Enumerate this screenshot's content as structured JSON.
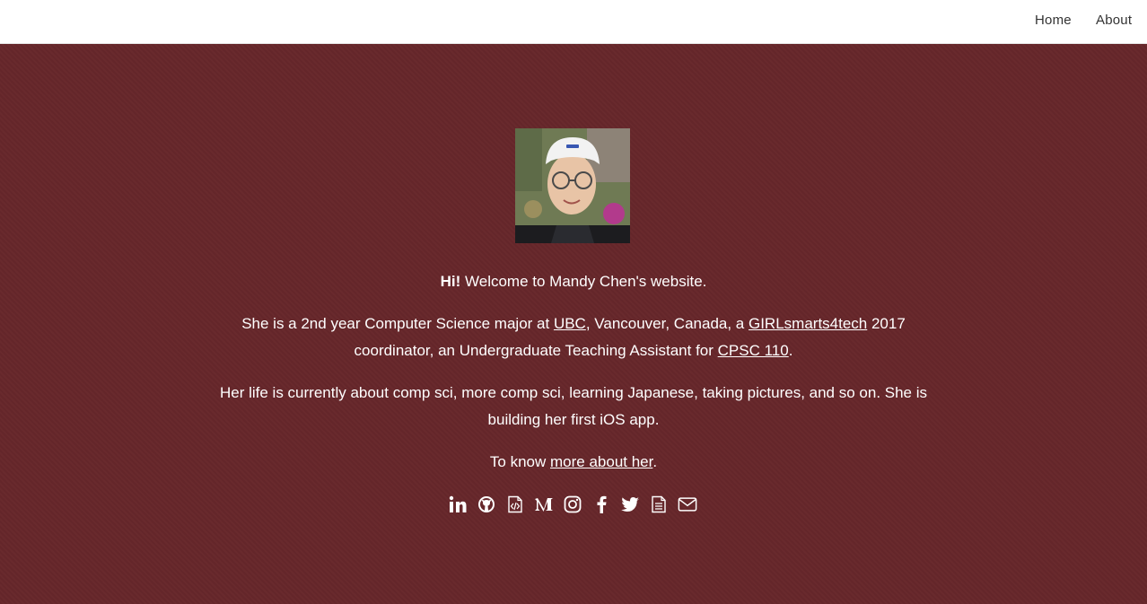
{
  "nav": {
    "home_label": "Home",
    "about_label": "About"
  },
  "hero": {
    "greeting_hi": "Hi!",
    "greeting_rest": " Welcome to Mandy Chen's website.",
    "intro": {
      "t1": "She is a 2nd year Computer Science major at ",
      "ubc_link": "UBC",
      "t2": ", Vancouver, Canada, a ",
      "girls_link": "GIRLsmarts4tech",
      "t3": " 2017 coordinator, an Undergraduate Teaching Assistant for ",
      "cpsc_link": "CPSC 110",
      "t4": "."
    },
    "life": "Her life is currently about comp sci, more comp sci, learning Japanese, taking pictures, and so on. She is building her first iOS app.",
    "more": {
      "t1": "To know ",
      "link": "more about her",
      "t2": "."
    }
  },
  "socials": [
    {
      "icon": "linkedin-icon"
    },
    {
      "icon": "github-icon"
    },
    {
      "icon": "code-file-icon"
    },
    {
      "icon": "medium-icon"
    },
    {
      "icon": "instagram-icon"
    },
    {
      "icon": "facebook-icon"
    },
    {
      "icon": "twitter-icon"
    },
    {
      "icon": "document-icon"
    },
    {
      "icon": "mail-icon"
    }
  ],
  "colors": {
    "hero_bg": "#67272b",
    "text": "#ffffff",
    "nav_text": "#333333"
  }
}
